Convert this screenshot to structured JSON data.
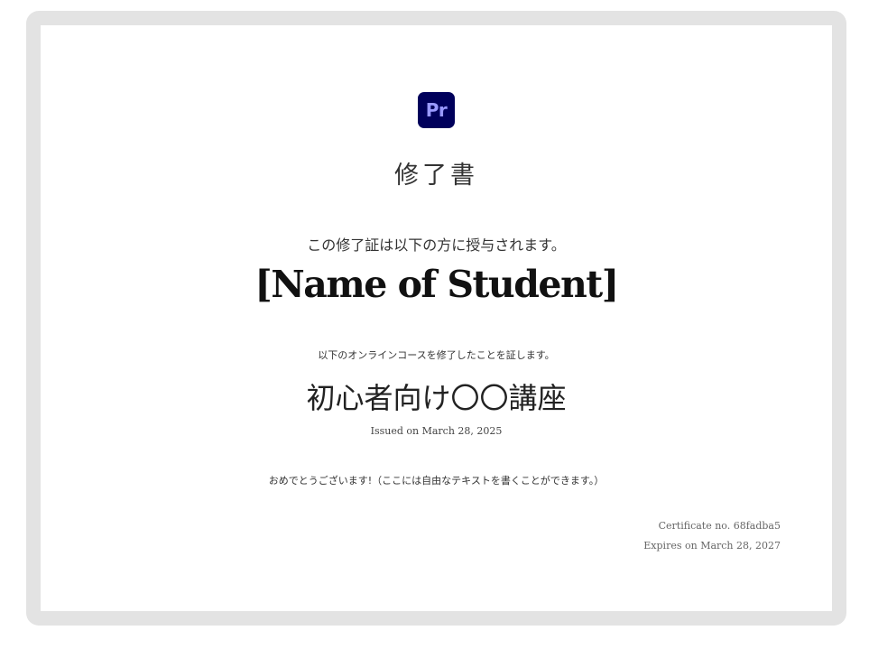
{
  "logo": {
    "text": "Pr",
    "background": "#00005b",
    "color": "#9999ff"
  },
  "certificate": {
    "title": "修了書",
    "awarded_text": "この修了証は以下の方に授与されます。",
    "student_name": "[Name of Student]",
    "completed_text": "以下のオンラインコースを修了したことを証します。",
    "course_name": "初心者向け〇〇講座",
    "issued": "Issued on March 28, 2025",
    "message": "おめでとうございます!（ここには自由なテキストを書くことができます。）",
    "certificate_no": "Certificate no. 68fadba5",
    "expires": "Expires on March 28, 2027"
  },
  "colors": {
    "frame": "#e3e3e3",
    "paper": "#ffffff"
  }
}
